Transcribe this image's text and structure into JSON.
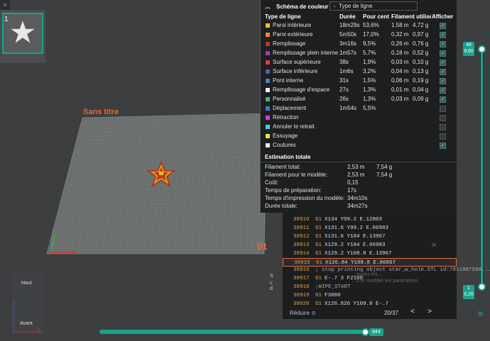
{
  "corner_toggle": ">",
  "plate": {
    "thumb_number": "1",
    "title": "Sans titre",
    "plate_number": "01"
  },
  "legend": {
    "collapse_icon": "chevron-up-icon",
    "title": "Schéma de couleur",
    "view_type": "Type de ligne",
    "columns": [
      "Type de ligne",
      "Durée",
      "Pour cent",
      "Filament utilisé",
      "Afficher"
    ],
    "rows": [
      {
        "label": "Paroi intérieure",
        "color": "#f2c21a",
        "time": "18m29s",
        "pct": "53,6%",
        "len": "1,58 m",
        "weight": "4,72 g",
        "shown": true
      },
      {
        "label": "Paroi extérieure",
        "color": "#ee8a22",
        "time": "5m50s",
        "pct": "17,0%",
        "len": "0,32 m",
        "weight": "0,97 g",
        "shown": true
      },
      {
        "label": "Remplissage",
        "color": "#b53b2c",
        "time": "3m16s",
        "pct": "9,5%",
        "len": "0,26 m",
        "weight": "0,76 g",
        "shown": true
      },
      {
        "label": "Remplissage plein interne",
        "color": "#9a3db8",
        "time": "1m57s",
        "pct": "5,7%",
        "len": "0,18 m",
        "weight": "0,52 g",
        "shown": true
      },
      {
        "label": "Surface supérieure",
        "color": "#e63a3a",
        "time": "38s",
        "pct": "1,9%",
        "len": "0,03 m",
        "weight": "0,10 g",
        "shown": true
      },
      {
        "label": "Surface inférieure",
        "color": "#5a5ab8",
        "time": "1m6s",
        "pct": "3,2%",
        "len": "0,04 m",
        "weight": "0,13 g",
        "shown": true
      },
      {
        "label": "Pont interne",
        "color": "#4a7ec8",
        "time": "31s",
        "pct": "1,5%",
        "len": "0,06 m",
        "weight": "0,19 g",
        "shown": true
      },
      {
        "label": "Remplissage d'espace",
        "color": "#f2f2f2",
        "time": "27s",
        "pct": "1,3%",
        "len": "0,01 m",
        "weight": "0,04 g",
        "shown": true
      },
      {
        "label": "Personnalisé",
        "color": "#2ec46a",
        "time": "26s",
        "pct": "1,3%",
        "len": "0,03 m",
        "weight": "0,09 g",
        "shown": true
      },
      {
        "label": "Déplacement",
        "color": "#3a7ad8",
        "time": "1m54s",
        "pct": "5,5%",
        "len": "",
        "weight": "",
        "shown": false
      },
      {
        "label": "Rétraction",
        "color": "#d83ad8",
        "time": "",
        "pct": "",
        "len": "",
        "weight": "",
        "shown": false
      },
      {
        "label": "Annuler le retrait",
        "color": "#3ad8d8",
        "time": "",
        "pct": "",
        "len": "",
        "weight": "",
        "shown": false
      },
      {
        "label": "Essuyage",
        "color": "#e8e83a",
        "time": "",
        "pct": "",
        "len": "",
        "weight": "",
        "shown": false
      },
      {
        "label": "Coutures",
        "color": "#e8e8e8",
        "time": "",
        "pct": "",
        "len": "",
        "weight": "",
        "shown": true
      }
    ],
    "estimate_title": "Estimation totale",
    "estimates": [
      {
        "label": "Filament total:",
        "v1": "2,53 m",
        "v2": "7,54 g"
      },
      {
        "label": "Filament pour le modèle:",
        "v1": "2,53 m",
        "v2": "7,54 g"
      },
      {
        "label": "Coût:",
        "v1": "0,15",
        "v2": ""
      },
      {
        "label": "Temps de préparation:",
        "v1": "17s",
        "v2": ""
      },
      {
        "label": "Temps d'impression du modèle:",
        "v1": "34m10s",
        "v2": ""
      },
      {
        "label": "Durée totale:",
        "v1": "34m27s",
        "v2": ""
      }
    ]
  },
  "vslider": {
    "top_line1": "48",
    "top_line2": "9,60",
    "bottom_line1": "1",
    "bottom_line2": "0,20",
    "icon": "layers-icon"
  },
  "gcode": {
    "lines": [
      {
        "n": "30910",
        "c": "G1",
        "a": "X134 Y99.2 E.12803"
      },
      {
        "n": "30911",
        "c": "G1",
        "a": "X131.6 Y99.2 E.06983"
      },
      {
        "n": "30912",
        "c": "G1",
        "a": "X131.6 Y104 E.13967"
      },
      {
        "n": "30913",
        "c": "G1",
        "a": "X129.2 Y104 E.06983"
      },
      {
        "n": "30914",
        "c": "G1",
        "a": "X129.2 Y108.8 E.13967"
      },
      {
        "n": "30915",
        "c": "G1",
        "a": "X126.84 Y108.8 E.06867"
      },
      {
        "n": "30916",
        "c": "",
        "a": "; stop printing object star_w_hole.STL id:7811887588..."
      },
      {
        "n": "30917",
        "c": "G1",
        "a": "E-.7 3 F2100"
      },
      {
        "n": "30918",
        "c": "",
        "a": ";WIPE_START"
      },
      {
        "n": "30919",
        "c": "G1",
        "a": "F3000"
      },
      {
        "n": "30920",
        "c": "G1",
        "a": "X126.826 Y109.8 E-.7"
      }
    ],
    "ghost1": "...toutes les...",
    "ghost2": "...u et modifier les paramètres",
    "close_icon": "close-icon",
    "reduce": "Réduire ≎",
    "page": "20/37",
    "prev": "<",
    "next": ">"
  },
  "ghost_left": [
    "S",
    "c",
    "d"
  ],
  "hslider": {
    "value": "844"
  },
  "gizmo": {
    "top": "Haut",
    "front": "Avant"
  }
}
